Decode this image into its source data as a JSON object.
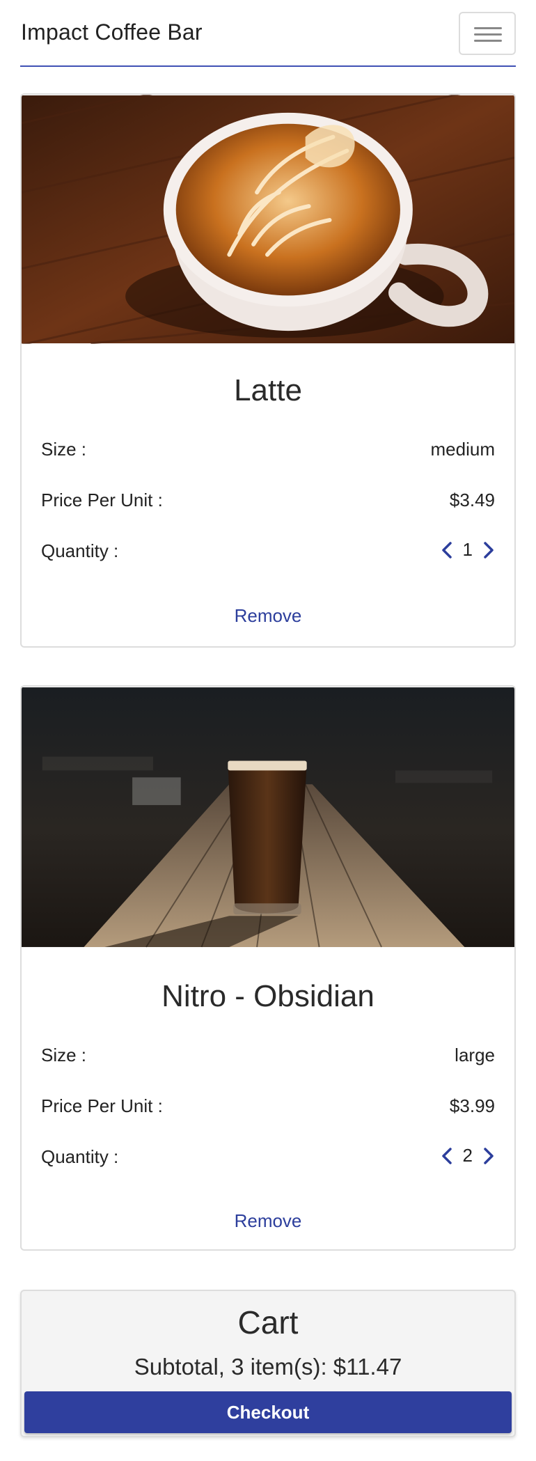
{
  "header": {
    "brand": "Impact Coffee Bar",
    "menu_icon": "hamburger-menu-icon"
  },
  "items": [
    {
      "name": "Latte",
      "image": "latte-art-photo",
      "size_label": "Size :",
      "size": "medium",
      "price_label": "Price Per Unit :",
      "price": "$3.49",
      "quantity_label": "Quantity :",
      "quantity": "1",
      "remove_label": "Remove"
    },
    {
      "name": "Nitro - Obsidian",
      "image": "nitro-glass-photo",
      "size_label": "Size :",
      "size": "large",
      "price_label": "Price Per Unit :",
      "price": "$3.99",
      "quantity_label": "Quantity :",
      "quantity": "2",
      "remove_label": "Remove"
    }
  ],
  "cart": {
    "title": "Cart",
    "subtotal": "Subtotal, 3 item(s): $11.47",
    "checkout_label": "Checkout"
  },
  "colors": {
    "accent": "#3f51b5",
    "link": "#2c3e9c",
    "button": "#2f3f9e"
  }
}
